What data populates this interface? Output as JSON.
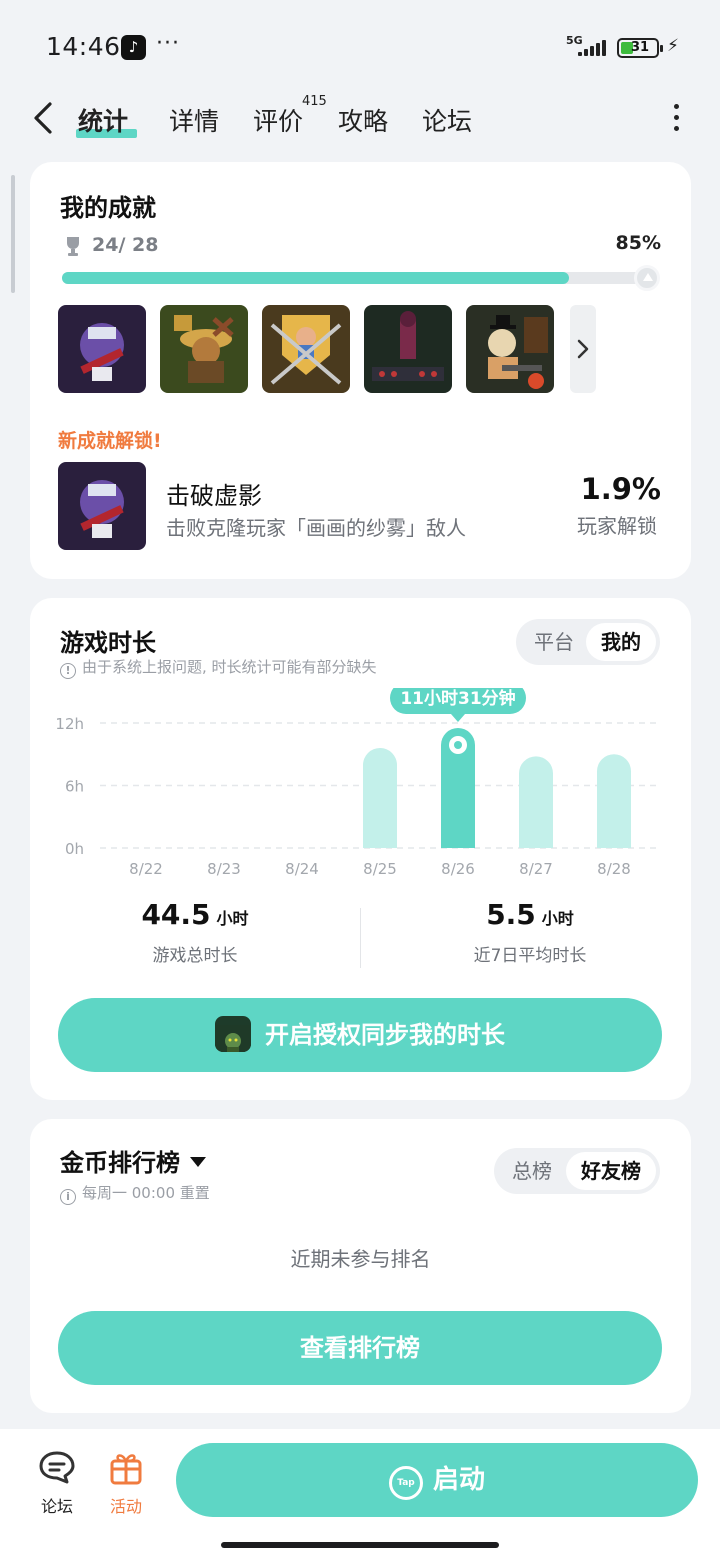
{
  "status_bar": {
    "time": "14:46",
    "network": "5G",
    "battery": "31"
  },
  "nav": {
    "tabs": [
      {
        "label": "统计",
        "active": true
      },
      {
        "label": "详情"
      },
      {
        "label": "评价",
        "badge": "415"
      },
      {
        "label": "攻略"
      },
      {
        "label": "论坛"
      }
    ]
  },
  "achievements": {
    "title": "我的成就",
    "count": "24/ 28",
    "percent": "85%",
    "progress_fraction": 0.85,
    "thumbnails": [
      "achievement-1",
      "achievement-2",
      "achievement-3",
      "achievement-4",
      "achievement-5"
    ],
    "new_unlock_label": "新成就解锁!",
    "new_unlock": {
      "name": "击破虚影",
      "description": "击败克隆玩家「画画的纱雾」敌人",
      "rate": "1.9%",
      "rate_label": "玩家解锁"
    }
  },
  "playtime": {
    "title": "游戏时长",
    "toggle": {
      "options": [
        "平台",
        "我的"
      ],
      "selected": "我的"
    },
    "note": "由于系统上报问题, 时长统计可能有部分缺失",
    "total_value": "44.5",
    "total_unit": "小时",
    "total_label": "游戏总时长",
    "avg_value": "5.5",
    "avg_unit": "小时",
    "avg_label": "近7日平均时长",
    "sync_button": "开启授权同步我的时长"
  },
  "chart_data": {
    "type": "bar",
    "categories": [
      "8/22",
      "8/23",
      "8/24",
      "8/25",
      "8/26",
      "8/27",
      "8/28"
    ],
    "values": [
      0,
      0,
      0,
      9.6,
      11.52,
      8.8,
      9.0
    ],
    "highlighted_index": 4,
    "highlight_label": "11小时31分钟",
    "y_ticks": [
      "12h",
      "6h",
      "0h"
    ],
    "ylim": [
      0,
      12
    ],
    "colors": {
      "bar": "#c3f0ea",
      "highlight": "#5ed6c5"
    }
  },
  "leaderboard": {
    "title": "金币排行榜",
    "toggle": {
      "options": [
        "总榜",
        "好友榜"
      ],
      "selected": "好友榜"
    },
    "note": "每周一 00:00 重置",
    "empty_text": "近期未参与排名",
    "view_button": "查看排行榜"
  },
  "bottom_bar": {
    "items": [
      {
        "label": "论坛",
        "icon": "forum-icon"
      },
      {
        "label": "活动",
        "icon": "gift-icon"
      }
    ],
    "launch_label": "启动",
    "launch_logo": "Tap"
  },
  "colors": {
    "accent": "#5ed6c5",
    "accent_light": "#c3f0ea",
    "orange": "#f07b3f"
  }
}
